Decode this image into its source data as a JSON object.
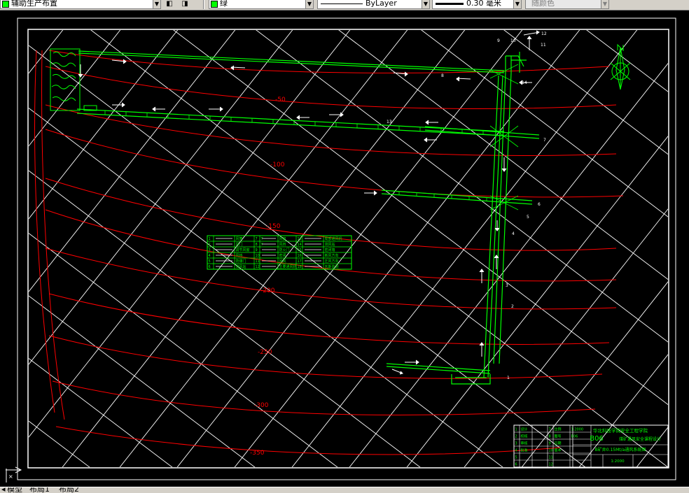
{
  "toolbar": {
    "layer_combo": {
      "value": "辅助生产布置",
      "icon": "layer-swatch-green"
    },
    "color_combo": {
      "value": "绿",
      "swatch": "#00ff00"
    },
    "linetype_combo": {
      "value": "ByLayer"
    },
    "lineweight_combo": {
      "value": "0.30 毫米"
    },
    "plotstyle_combo": {
      "value": "随颜色"
    },
    "icons": [
      "layer-state-icon",
      "layer-previous-icon"
    ]
  },
  "drawing": {
    "contour_labels": [
      "-50",
      "-100",
      "-150",
      "-200",
      "-250",
      "-300",
      "-350"
    ],
    "point_numbers": [
      "1",
      "2",
      "3",
      "4",
      "5",
      "6",
      "7",
      "8",
      "9",
      "10",
      "11",
      "12",
      "13",
      "14"
    ],
    "legend_cells": [
      [
        "1",
        "",
        "风筒",
        "7",
        "T",
        "风窗",
        "13",
        "",
        "局部通风机"
      ],
      [
        "2",
        "",
        "风门",
        "8",
        "Y",
        "风桥",
        "14",
        "",
        "测风站"
      ],
      [
        "3",
        "",
        "调节风窗",
        "9",
        "",
        "防火门",
        "15",
        "",
        "密闭墙"
      ],
      [
        "4",
        "",
        "风桥",
        "10",
        "",
        "密闭",
        "16",
        "",
        "新风方向"
      ],
      [
        "5",
        "",
        "防爆门",
        "11",
        "",
        "回风",
        "17",
        "",
        "乏风方向"
      ],
      [
        "6",
        "",
        "测风站",
        "12",
        "",
        "主要通风机",
        "18",
        "",
        "瓦斯监测"
      ]
    ],
    "title_block": {
      "school": "华北科技学院安全工程学院",
      "code": "B06",
      "project": "煤矿通风安全课程设计",
      "drawing_name": "B矿井0.15Mt/a通风系统图",
      "scale": "1:2000",
      "rows": [
        [
          "1",
          "设计",
          "",
          "7",
          "比例",
          "1:2000"
        ],
        [
          "2",
          "校核",
          "",
          "8",
          "图号",
          "B06"
        ],
        [
          "3",
          "审核",
          "",
          "9",
          "日期",
          ""
        ],
        [
          "4",
          "批准",
          "",
          "10",
          "版本",
          ""
        ],
        [
          "5",
          "",
          "",
          "11",
          "",
          ""
        ],
        [
          "6",
          "",
          "",
          "12",
          "",
          ""
        ]
      ]
    }
  },
  "status": {
    "tabs": [
      "模型",
      "布局1",
      "布局2"
    ]
  },
  "colors": {
    "background": "#000000",
    "grid": "#ffffff",
    "contours": "#ff0000",
    "roadways": "#00ff00",
    "ui_face": "#d4d0c8"
  }
}
